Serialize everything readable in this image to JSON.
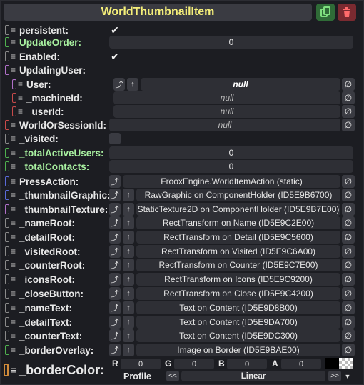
{
  "header": {
    "title": "WorldThumbnailItem",
    "duplicate_icon": "duplicate-icon",
    "delete_icon": "trash-icon"
  },
  "colors": {
    "title": "#f6f07a",
    "green_label": "#a8f0a0",
    "dup_btn": "#2f6b37",
    "del_btn": "#7a2a30"
  },
  "fields": {
    "persistent": {
      "label": "persistent:",
      "value": "✔"
    },
    "updateOrder": {
      "label": "UpdateOrder:",
      "value": "0"
    },
    "enabled": {
      "label": "Enabled:",
      "value": "✔"
    },
    "updatingUser": {
      "label": "UpdatingUser:"
    },
    "user": {
      "label": "User:",
      "value": "null"
    },
    "machineId": {
      "label": "_machineId:",
      "value": "null"
    },
    "userId": {
      "label": "_userId:",
      "value": "null"
    },
    "worldOrSessionId": {
      "label": "WorldOrSessionId:",
      "value": "null"
    },
    "visited": {
      "label": "_visited:"
    },
    "totalActiveUsers": {
      "label": "_totalActiveUsers:",
      "value": "0"
    },
    "totalContacts": {
      "label": "_totalContacts:",
      "value": "0"
    },
    "pressAction": {
      "label": "PressAction:",
      "value": "FrooxEngine.WorldItemAction (static)"
    },
    "thumbnailGraphic": {
      "label": "_thumbnailGraphic:",
      "value": "RawGraphic on ComponentHolder (ID5E9B6700)"
    },
    "thumbnailTexture": {
      "label": "_thumbnailTexture:",
      "value": "StaticTexture2D on ComponentHolder (ID5E9B7E00)"
    },
    "nameRoot": {
      "label": "_nameRoot:",
      "value": "RectTransform on Name (ID5E9C2E00)"
    },
    "detailRoot": {
      "label": "_detailRoot:",
      "value": "RectTransform on Detail (ID5E9C5600)"
    },
    "visitedRoot": {
      "label": "_visitedRoot:",
      "value": "RectTransform on Visited (ID5E9C6A00)"
    },
    "counterRoot": {
      "label": "_counterRoot:",
      "value": "RectTransform on Counter (ID5E9C7E00)"
    },
    "iconsRoot": {
      "label": "_iconsRoot:",
      "value": "RectTransform on Icons (ID5E9C9200)"
    },
    "closeButton": {
      "label": "_closeButton:",
      "value": "RectTransform on Close (ID5E9C4200)"
    },
    "nameText": {
      "label": "_nameText:",
      "value": "Text on Content (ID5E9D8B00)"
    },
    "detailText": {
      "label": "_detailText:",
      "value": "Text on Content (ID5E9DA700)"
    },
    "counterText": {
      "label": "_counterText:",
      "value": "Text on Content (ID5E9DC300)"
    },
    "borderOverlay": {
      "label": "_borderOverlay:",
      "value": "Image on Border (ID5E9BAE00)"
    }
  },
  "borderColor": {
    "label": "_borderColor:",
    "r_label": "R",
    "r": "0",
    "g_label": "G",
    "g": "0",
    "b_label": "B",
    "b": "0",
    "a_label": "A",
    "a": "0",
    "profile_label": "Profile",
    "profile_value": "Linear",
    "prev": "<<",
    "next": ">>",
    "dropdown": "▼"
  },
  "icons": {
    "clear": "∅",
    "jump": "⤴",
    "up": "↑"
  }
}
